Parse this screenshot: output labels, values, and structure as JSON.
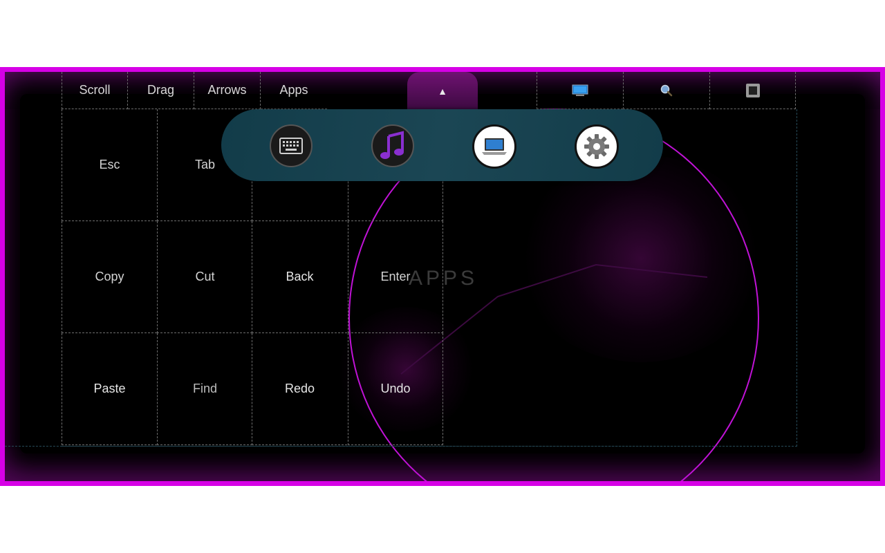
{
  "top_tabs": [
    "Scroll",
    "Drag",
    "Arrows",
    "Apps"
  ],
  "toggle_symbol": "▲",
  "right_icons": [
    "monitor-icon",
    "magnifier-icon",
    "stop-square-icon"
  ],
  "keys": {
    "esc": "Esc",
    "tab": "Tab",
    "copy": "Copy",
    "cut": "Cut",
    "back": "Back",
    "enter": "Enter",
    "paste": "Paste",
    "find": "Find",
    "redo": "Redo",
    "undo": "Undo"
  },
  "watermark": "APPS",
  "launcher_apps": [
    "keyboard-icon",
    "music-note-icon",
    "laptop-icon",
    "gear-icon"
  ],
  "colors": {
    "frame_border": "#d600e6",
    "frame_bg": "#4a0650",
    "circle": "#c012d6",
    "launcher_bg": "#1b4654"
  }
}
